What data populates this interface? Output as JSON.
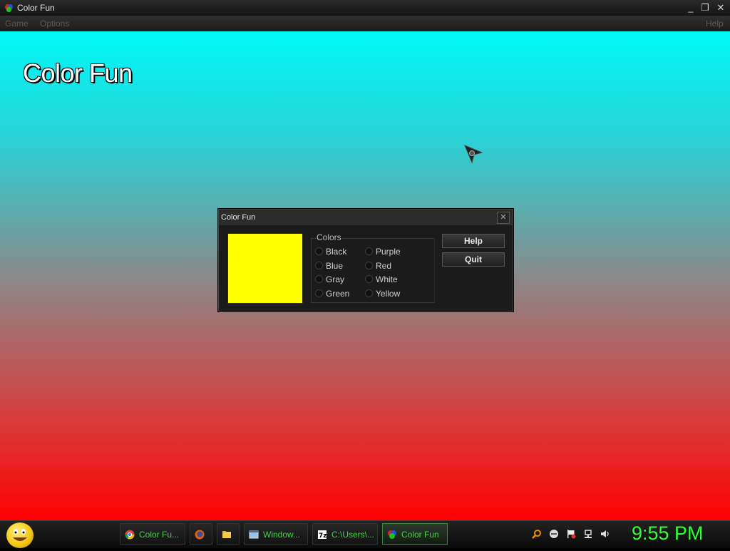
{
  "window": {
    "title": "Color Fun",
    "controls": {
      "minimize": "_",
      "restore": "❐",
      "close": "✕"
    }
  },
  "menu": {
    "game": "Game",
    "options": "Options",
    "help": "Help"
  },
  "content": {
    "heading": "Color Fun"
  },
  "dialog": {
    "title": "Color Fun",
    "close": "✕",
    "swatch_color": "#ffff00",
    "group_label": "Colors",
    "colors_left": [
      "Black",
      "Blue",
      "Gray",
      "Green"
    ],
    "colors_right": [
      "Purple",
      "Red",
      "White",
      "Yellow"
    ],
    "help_label": "Help",
    "quit_label": "Quit"
  },
  "taskbar": {
    "tasks": [
      {
        "label": "Color Fu...",
        "icon": "chrome-icon"
      },
      {
        "label": "",
        "icon": "firefox-icon"
      },
      {
        "label": "",
        "icon": "folder-icon"
      },
      {
        "label": "Window...",
        "icon": "window-icon"
      },
      {
        "label": "C:\\Users\\...",
        "icon": "7zip-icon"
      },
      {
        "label": "Color Fun",
        "icon": "colorfun-icon"
      }
    ],
    "clock": "9:55 PM"
  }
}
